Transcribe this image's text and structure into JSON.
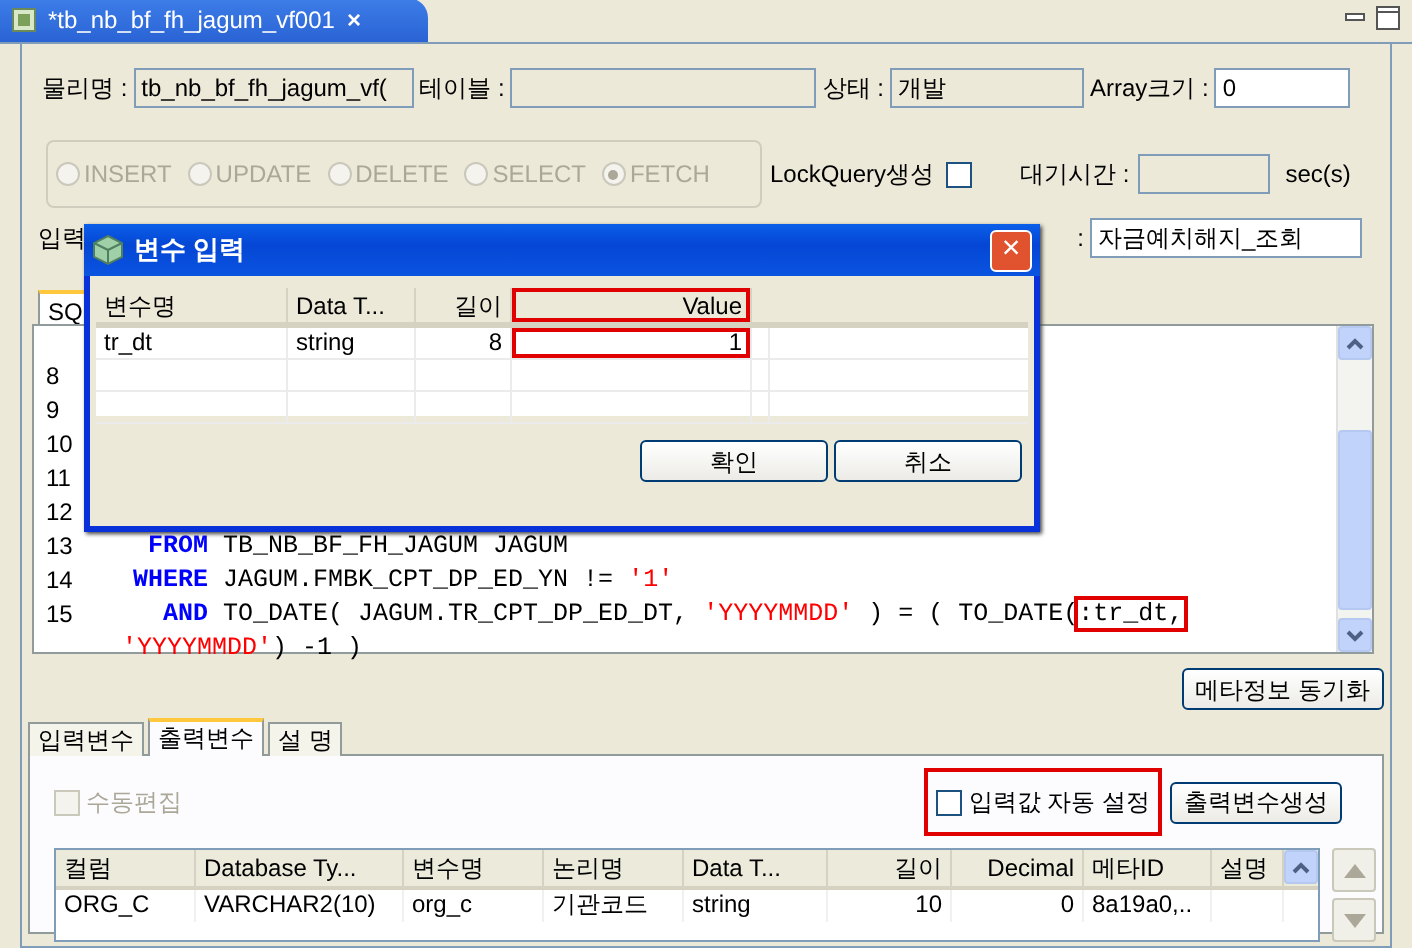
{
  "editor_tab": {
    "title": "*tb_nb_bf_fh_jagum_vf001",
    "close": "×"
  },
  "fields": [
    {
      "label": "물리명 :",
      "value": "tb_nb_bf_fh_jagum_vf("
    },
    {
      "label": "테이블 :"
    },
    {
      "label": "상태 :",
      "value": "개발"
    },
    {
      "label": "Array크기 :",
      "value": "0"
    }
  ],
  "operations": [
    {
      "label": "INSERT",
      "selected": false
    },
    {
      "label": "UPDATE",
      "selected": false
    },
    {
      "label": "DELETE",
      "selected": false
    },
    {
      "label": "SELECT",
      "selected": false
    },
    {
      "label": "FETCH",
      "selected": true
    }
  ],
  "lock_query": {
    "label": "LockQuery생성",
    "checked": false
  },
  "wait_time": {
    "label": "대기시간 :",
    "unit": "sec(s)"
  },
  "input_label": "입력",
  "name_field": {
    "label": ":",
    "value": "자금예치해지_조회"
  },
  "sql_tab": "SQ",
  "sql_lines": [
    {
      "number": "8"
    },
    {
      "number": "9"
    },
    {
      "number": "10"
    },
    {
      "number": "11"
    },
    {
      "number": "12"
    },
    {
      "number": "13",
      "tokens": [
        {
          "kind": "keyword",
          "text": "  FROM"
        },
        {
          "kind": "plain",
          "text": " TB_NB_BF_FH_JAGUM JAGUM"
        }
      ]
    },
    {
      "number": "14",
      "tokens": [
        {
          "kind": "keyword",
          "text": " WHERE"
        },
        {
          "kind": "plain",
          "text": " JAGUM.FMBK_CPT_DP_ED_YN != "
        },
        {
          "kind": "string",
          "text": "'1'"
        }
      ]
    },
    {
      "number": "15",
      "tokens": [
        {
          "kind": "keyword",
          "text": "   AND"
        },
        {
          "kind": "plain",
          "text": " TO_DATE( JAGUM.TR_CPT_DP_ED_DT, "
        },
        {
          "kind": "string",
          "text": "'YYYYMMDD'"
        },
        {
          "kind": "plain",
          "text": " ) = ( TO_DATE("
        },
        {
          "kind": "plain",
          "text": ":tr_dt,",
          "highlighted": true
        }
      ]
    },
    {
      "tokens": [
        {
          "kind": "string",
          "text": "'YYYYMMDD'"
        },
        {
          "kind": "plain",
          "text": ") -1 )"
        }
      ]
    }
  ],
  "meta_sync_button": "메타정보 동기화",
  "bottom_tabs": [
    {
      "label": "입력변수",
      "selected": false
    },
    {
      "label": "출력변수",
      "selected": true
    },
    {
      "label": "설 명",
      "selected": false
    }
  ],
  "manual_edit": {
    "label": "수동편집",
    "checked": false,
    "disabled": true
  },
  "auto_input": {
    "label": "입력값 자동 설정",
    "checked": false,
    "highlighted": true
  },
  "generate_button": "출력변수생성",
  "output_table": {
    "columns": [
      {
        "label": "컬럼",
        "kind": "text"
      },
      {
        "label": "Database Ty...",
        "kind": "text"
      },
      {
        "label": "변수명",
        "kind": "text"
      },
      {
        "label": "논리명",
        "kind": "text"
      },
      {
        "label": "Data T...",
        "kind": "text"
      },
      {
        "label": "길이",
        "kind": "number"
      },
      {
        "label": "Decimal",
        "kind": "number"
      },
      {
        "label": "메타ID",
        "kind": "text"
      },
      {
        "label": "설명",
        "kind": "text"
      }
    ],
    "rows": [
      [
        "ORG_C",
        "VARCHAR2(10)",
        "org_c",
        "기관코드",
        "string",
        "10",
        "0",
        "8a19a0,.."
      ]
    ]
  },
  "dialog": {
    "title": "변수 입력",
    "close": "×",
    "columns": [
      {
        "label": "변수명",
        "kind": "text",
        "highlighted": false
      },
      {
        "label": "Data T...",
        "kind": "text",
        "highlighted": false
      },
      {
        "label": "길이",
        "kind": "number",
        "highlighted": false
      },
      {
        "label": "Value",
        "kind": "number",
        "highlighted": true
      }
    ],
    "rows": [
      [
        "tr_dt",
        "string",
        "8",
        "1"
      ]
    ],
    "buttons": [
      "확인",
      "취소"
    ]
  }
}
